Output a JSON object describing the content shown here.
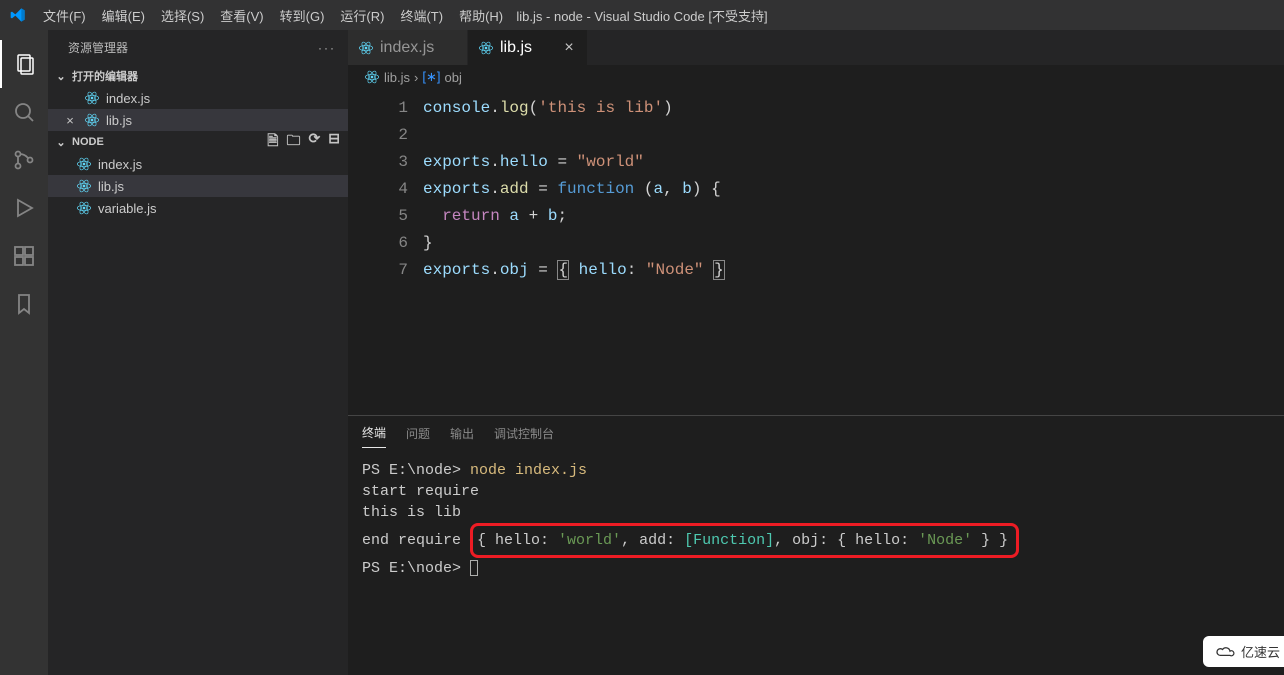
{
  "window_title": "lib.js - node - Visual Studio Code [不受支持]",
  "menu": {
    "items": [
      "文件(F)",
      "编辑(E)",
      "选择(S)",
      "查看(V)",
      "转到(G)",
      "运行(R)",
      "终端(T)",
      "帮助(H)"
    ]
  },
  "activitybar": {
    "items": [
      {
        "name": "explorer-icon",
        "active": true
      },
      {
        "name": "search-icon",
        "active": false
      },
      {
        "name": "source-control-icon",
        "active": false
      },
      {
        "name": "run-debug-icon",
        "active": false
      },
      {
        "name": "extensions-icon",
        "active": false
      },
      {
        "name": "bookmarks-icon",
        "active": false
      }
    ]
  },
  "explorer": {
    "header": "资源管理器",
    "open_editors": {
      "label": "打开的编辑器",
      "items": [
        {
          "name": "index.js",
          "close": false
        },
        {
          "name": "lib.js",
          "close": true,
          "active": true
        }
      ]
    },
    "folder": {
      "label": "NODE",
      "items": [
        {
          "name": "index.js"
        },
        {
          "name": "lib.js",
          "active": true
        },
        {
          "name": "variable.js"
        }
      ]
    }
  },
  "tabs": [
    {
      "label": "index.js",
      "active": false
    },
    {
      "label": "lib.js",
      "active": true
    }
  ],
  "breadcrumb": {
    "file": "lib.js",
    "symbol": "obj"
  },
  "editor": {
    "line_numbers": [
      1,
      2,
      3,
      4,
      5,
      6,
      7
    ],
    "code_lines": [
      {
        "n": 1,
        "segs": [
          {
            "t": "console",
            "c": "c-var"
          },
          {
            "t": ".",
            "c": "c-pun"
          },
          {
            "t": "log",
            "c": "c-fn"
          },
          {
            "t": "(",
            "c": "c-pun"
          },
          {
            "t": "'this is lib'",
            "c": "c-str"
          },
          {
            "t": ")",
            "c": "c-pun"
          }
        ]
      },
      {
        "n": 2,
        "segs": []
      },
      {
        "n": 3,
        "segs": [
          {
            "t": "exports",
            "c": "c-var"
          },
          {
            "t": ".",
            "c": "c-pun"
          },
          {
            "t": "hello",
            "c": "c-var"
          },
          {
            "t": " = ",
            "c": "c-pun"
          },
          {
            "t": "\"world\"",
            "c": "c-str"
          }
        ]
      },
      {
        "n": 4,
        "segs": [
          {
            "t": "exports",
            "c": "c-var"
          },
          {
            "t": ".",
            "c": "c-pun"
          },
          {
            "t": "add",
            "c": "c-fn"
          },
          {
            "t": " = ",
            "c": "c-pun"
          },
          {
            "t": "function",
            "c": "c-kw"
          },
          {
            "t": " (",
            "c": "c-pun"
          },
          {
            "t": "a",
            "c": "c-var"
          },
          {
            "t": ", ",
            "c": "c-pun"
          },
          {
            "t": "b",
            "c": "c-var"
          },
          {
            "t": ") {",
            "c": "c-pun"
          }
        ]
      },
      {
        "n": 5,
        "segs": [
          {
            "t": "  ",
            "c": "c-pun"
          },
          {
            "t": "return",
            "c": "c-kw2"
          },
          {
            "t": " ",
            "c": "c-pun"
          },
          {
            "t": "a",
            "c": "c-var"
          },
          {
            "t": " + ",
            "c": "c-pun"
          },
          {
            "t": "b",
            "c": "c-var"
          },
          {
            "t": ";",
            "c": "c-pun"
          }
        ]
      },
      {
        "n": 6,
        "segs": [
          {
            "t": "}",
            "c": "c-pun"
          }
        ]
      },
      {
        "n": 7,
        "segs": [
          {
            "t": "exports",
            "c": "c-var"
          },
          {
            "t": ".",
            "c": "c-pun"
          },
          {
            "t": "obj",
            "c": "c-var"
          },
          {
            "t": " = ",
            "c": "c-pun"
          },
          {
            "t": "{",
            "c": "c-pun c-brace-hl"
          },
          {
            "t": " ",
            "c": "c-pun"
          },
          {
            "t": "hello",
            "c": "c-var"
          },
          {
            "t": ":",
            "c": "c-pun"
          },
          {
            "t": " ",
            "c": "c-pun"
          },
          {
            "t": "\"Node\"",
            "c": "c-str"
          },
          {
            "t": " ",
            "c": "c-pun"
          },
          {
            "t": "}",
            "c": "c-pun c-brace-hl"
          }
        ]
      }
    ]
  },
  "panel": {
    "tabs": [
      "终端",
      "问题",
      "输出",
      "调试控制台"
    ],
    "active_tab": "终端",
    "terminal_lines": [
      {
        "plain": "PS E:\\node> ",
        "cmd": "node index.js"
      },
      {
        "plain": "start require"
      },
      {
        "plain": "this is lib"
      },
      {
        "boxed": true,
        "pre": "end require ",
        "obj": "{ hello: 'world', add: [Function], obj: { hello: 'Node' } }"
      },
      {
        "plain": "PS E:\\node> ",
        "cursor": true
      }
    ]
  },
  "watermark": "亿速云"
}
